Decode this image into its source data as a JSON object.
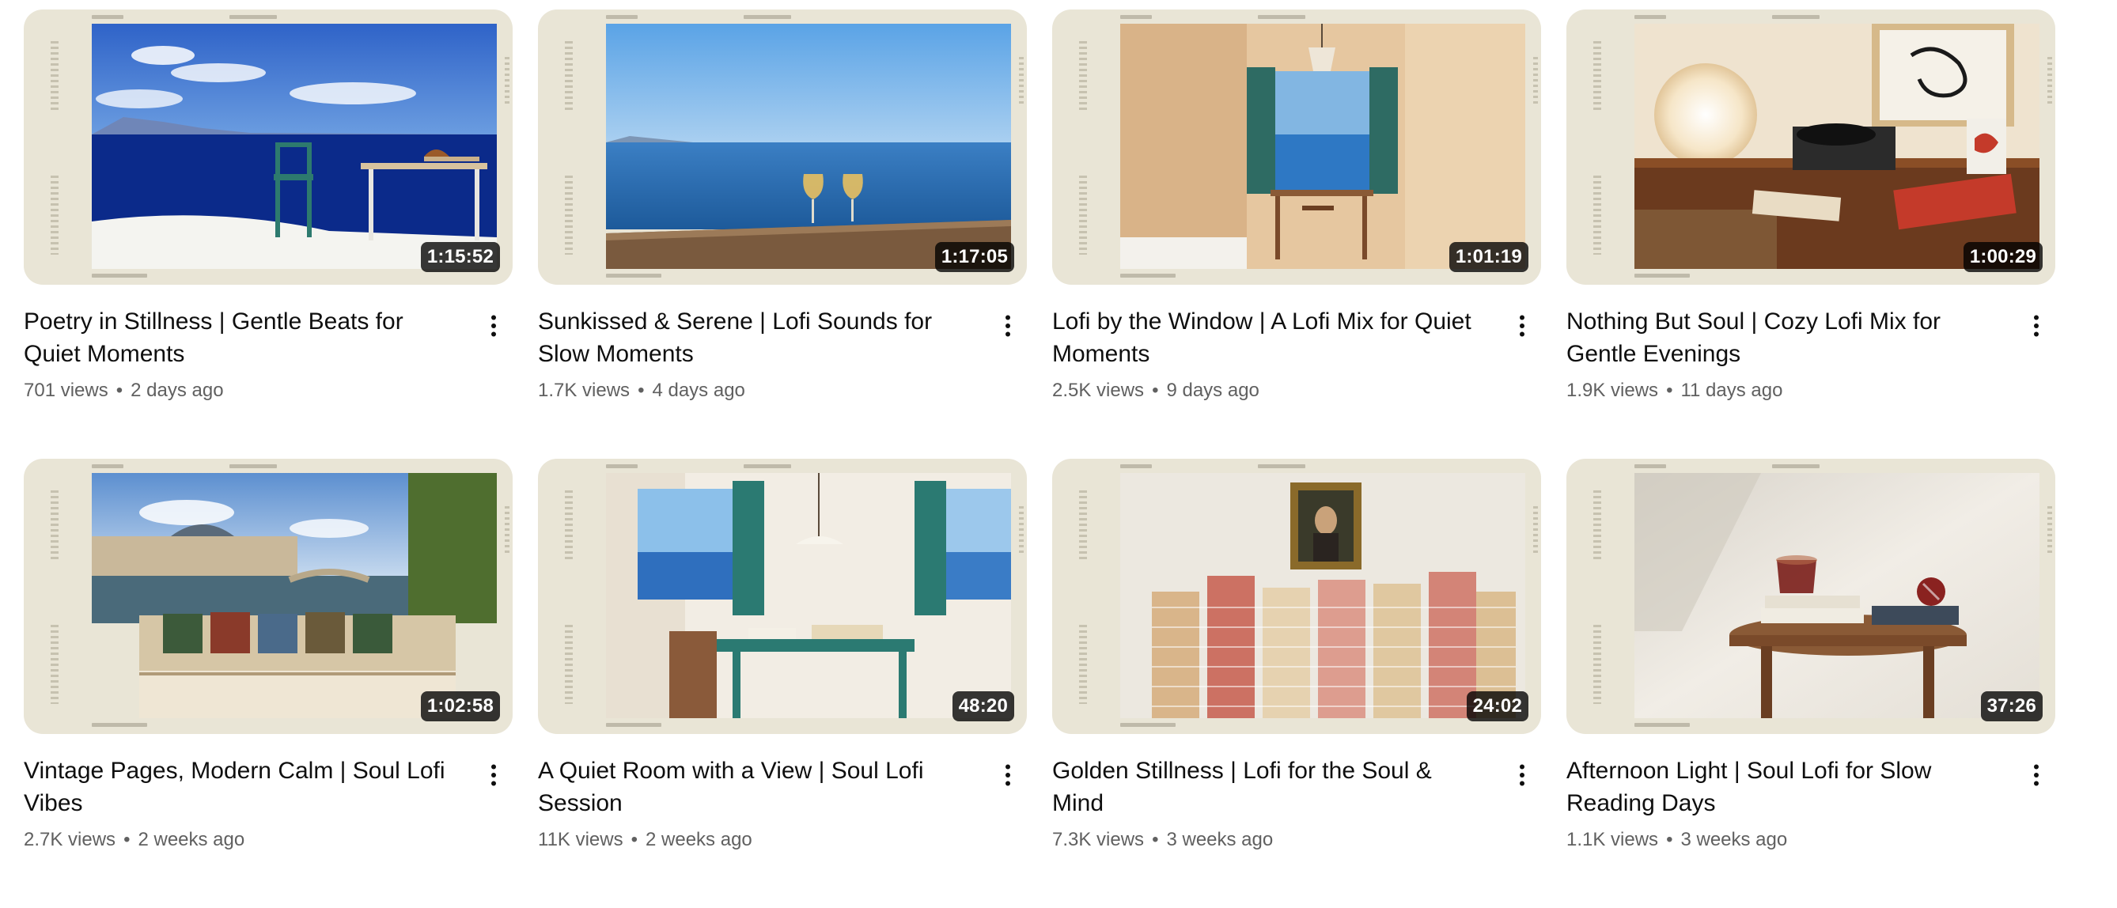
{
  "videos": [
    {
      "title": "Poetry in Stillness | Gentle Beats for Quiet Moments",
      "duration": "1:15:52",
      "views": "701 views",
      "age": "2 days ago",
      "scene": "Seaside terrace with blue sea, white wall, chairs and table",
      "palette": [
        "#3a6fd1",
        "#0d2f8a",
        "#f5f5f2",
        "#2d7a6e"
      ]
    },
    {
      "title": "Sunkissed & Serene | Lofi Sounds for Slow Moments",
      "duration": "1:17:05",
      "views": "1.7K views",
      "age": "4 days ago",
      "scene": "Open sea view with two glasses of white wine on a ledge",
      "palette": [
        "#6aaee8",
        "#2a6fb5",
        "#8c6a4a",
        "#e8c060"
      ]
    },
    {
      "title": "Lofi by the Window | A Lofi Mix for Quiet Moments",
      "duration": "1:01:19",
      "views": "2.5K views",
      "age": "9 days ago",
      "scene": "Warm room with open green shutters overlooking the sea",
      "palette": [
        "#e8c9a2",
        "#c79d6f",
        "#2e6b63",
        "#7fb3df"
      ]
    },
    {
      "title": "Nothing But Soul | Cozy Lofi Mix for Gentle Evenings",
      "duration": "1:00:29",
      "views": "1.9K views",
      "age": "11 days ago",
      "scene": "Globe lamp, record player and framed art on a wooden sideboard",
      "palette": [
        "#f0e4d0",
        "#6b3a1e",
        "#2b2b2b",
        "#c43a2a"
      ]
    },
    {
      "title": "Vintage Pages, Modern Calm | Soul Lofi Vibes",
      "duration": "1:02:58",
      "views": "2.7K views",
      "age": "2 weeks ago",
      "scene": "Paris riverbank with old book stalls and classic buildings",
      "palette": [
        "#8fb4e0",
        "#c9b89a",
        "#4a6a7a",
        "#6d8a3f"
      ]
    },
    {
      "title": "A Quiet Room with a View | Soul Lofi Session",
      "duration": "48:20",
      "views": "11K views",
      "age": "2 weeks ago",
      "scene": "Whitewashed room with teal shutters, desk and sea view",
      "palette": [
        "#f2ede4",
        "#2b7a72",
        "#3f78c0",
        "#8a5a3a"
      ]
    },
    {
      "title": "Golden Stillness | Lofi for the Soul & Mind",
      "duration": "24:02",
      "views": "7.3K views",
      "age": "3 weeks ago",
      "scene": "Stacks of books beneath a framed portrait",
      "palette": [
        "#ece8e0",
        "#d9b58a",
        "#c24a3a",
        "#4a3a2a"
      ]
    },
    {
      "title": "Afternoon Light | Soul Lofi for Slow Reading Days",
      "duration": "37:26",
      "views": "1.1K views",
      "age": "3 weeks ago",
      "scene": "Glass teacup on books atop a round wooden stool with a pomegranate",
      "palette": [
        "#eeeae2",
        "#8a5a36",
        "#7a1e1a",
        "#3d4a5a"
      ]
    }
  ]
}
